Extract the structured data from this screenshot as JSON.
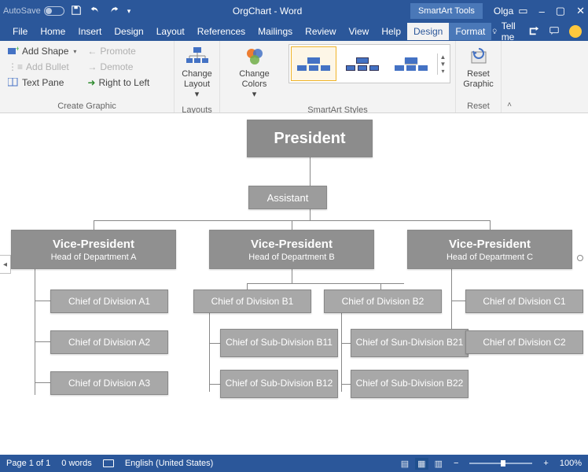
{
  "titlebar": {
    "autosave_label": "AutoSave",
    "doc_title": "OrgChart - Word",
    "tools_tab": "SmartArt Tools",
    "user": "Olga"
  },
  "menu": {
    "tabs": [
      "File",
      "Home",
      "Insert",
      "Design",
      "Layout",
      "References",
      "Mailings",
      "Review",
      "View",
      "Help"
    ],
    "smartart_tabs": [
      "Design",
      "Format"
    ],
    "tellme": "Tell me"
  },
  "ribbon": {
    "create_graphic": {
      "label": "Create Graphic",
      "add_shape": "Add Shape",
      "add_bullet": "Add Bullet",
      "text_pane": "Text Pane",
      "promote": "Promote",
      "demote": "Demote",
      "right_to_left": "Right to Left"
    },
    "layouts": {
      "label": "Layouts",
      "change_layout": "Change Layout"
    },
    "change_colors": "Change Colors",
    "styles_label": "SmartArt Styles",
    "reset": {
      "label": "Reset",
      "reset_graphic": "Reset Graphic"
    }
  },
  "org": {
    "president": "President",
    "assistant": "Assistant",
    "vp_title": "Vice-President",
    "deptA": "Head of Department A",
    "deptB": "Head of Department B",
    "deptC": "Head of Department C",
    "a1": "Chief of Division A1",
    "a2": "Chief of Division A2",
    "a3": "Chief of Division A3",
    "b1": "Chief of Division B1",
    "b2": "Chief of Division B2",
    "b11": "Chief of Sub-Division B11",
    "b12": "Chief of Sub-Division B12",
    "b21": "Chief of Sun-Division B21",
    "b22": "Chief of Sub-Division B22",
    "c1": "Chief of Division C1",
    "c2": "Chief of Division C2"
  },
  "status": {
    "page": "Page 1 of 1",
    "words": "0 words",
    "lang": "English (United States)",
    "zoom": "100%"
  }
}
